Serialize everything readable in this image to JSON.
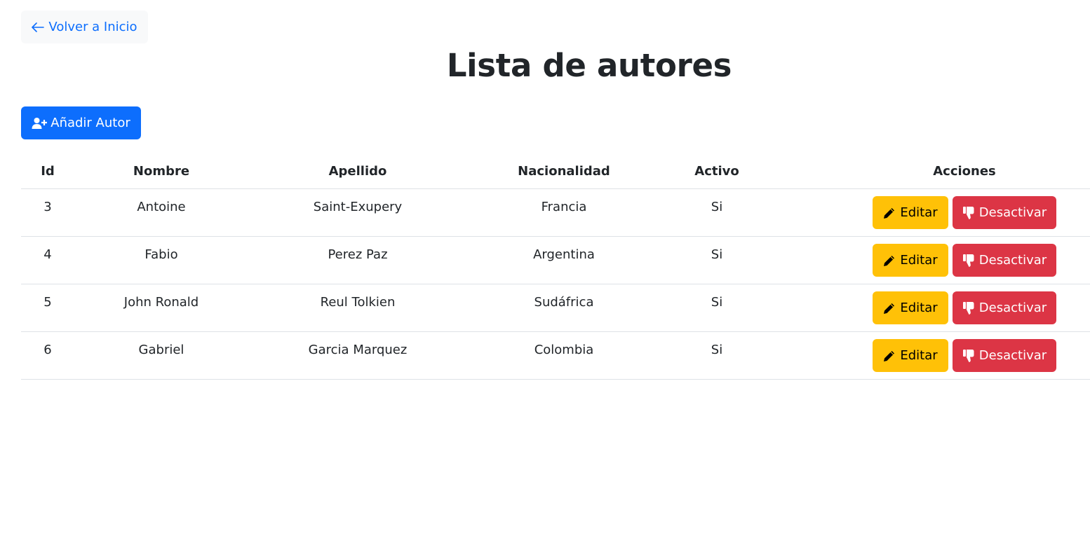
{
  "colors": {
    "primary": "#0d6efd",
    "warning": "#ffc107",
    "danger": "#dc3545",
    "light": "#f8f9fa",
    "text": "#212529"
  },
  "nav": {
    "back_label": "Volver a Inicio",
    "back_icon": "arrow-left-icon"
  },
  "page": {
    "title": "Lista de autores"
  },
  "toolbar": {
    "add_label": "Añadir Autor",
    "add_icon": "user-plus-icon"
  },
  "table": {
    "headers": {
      "id": "Id",
      "nombre": "Nombre",
      "apellido": "Apellido",
      "nacionalidad": "Nacionalidad",
      "activo": "Activo",
      "acciones": "Acciones"
    },
    "rows": [
      {
        "id": "3",
        "nombre": "Antoine",
        "apellido": "Saint-Exupery",
        "nacionalidad": "Francia",
        "activo": "Si"
      },
      {
        "id": "4",
        "nombre": "Fabio",
        "apellido": "Perez Paz",
        "nacionalidad": "Argentina",
        "activo": "Si"
      },
      {
        "id": "5",
        "nombre": "John Ronald",
        "apellido": "Reul Tolkien",
        "nacionalidad": "Sudáfrica",
        "activo": "Si"
      },
      {
        "id": "6",
        "nombre": "Gabriel",
        "apellido": "Garcia Marquez",
        "nacionalidad": "Colombia",
        "activo": "Si"
      }
    ],
    "actions": {
      "edit_label": "Editar",
      "edit_icon": "pencil-icon",
      "deactivate_label": "Desactivar",
      "deactivate_icon": "thumbs-down-icon"
    }
  }
}
